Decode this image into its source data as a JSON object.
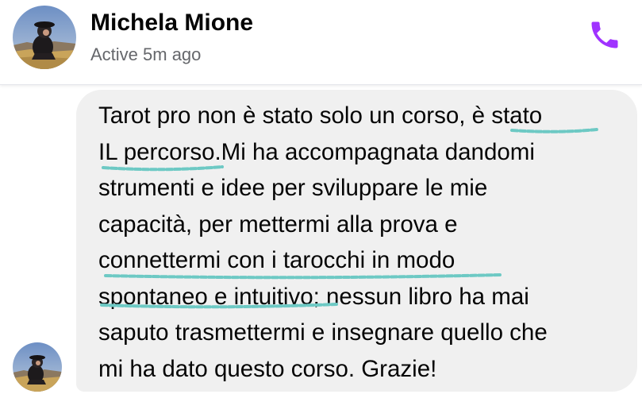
{
  "contact": {
    "name": "Michela Mione",
    "status": "Active 5m ago"
  },
  "header": {
    "call_icon": "phone-icon",
    "accent_color": "#a033ff"
  },
  "message": {
    "text": "Tarot pro non è stato solo un corso, è stato\nIL percorso.Mi ha accompagnata dandomi\nstrumenti e idee per sviluppare le mie\ncapacità, per mettermi alla prova e\nconnettermi con i tarocchi in modo\nspontaneo e intuitivo; nessun libro ha mai\nsaputo trasmettermi e insegnare quello che\nmi ha dato questo corso. Grazie!",
    "bubble_color": "#f0f0f0",
    "underline_color": "#6dc9c4"
  }
}
